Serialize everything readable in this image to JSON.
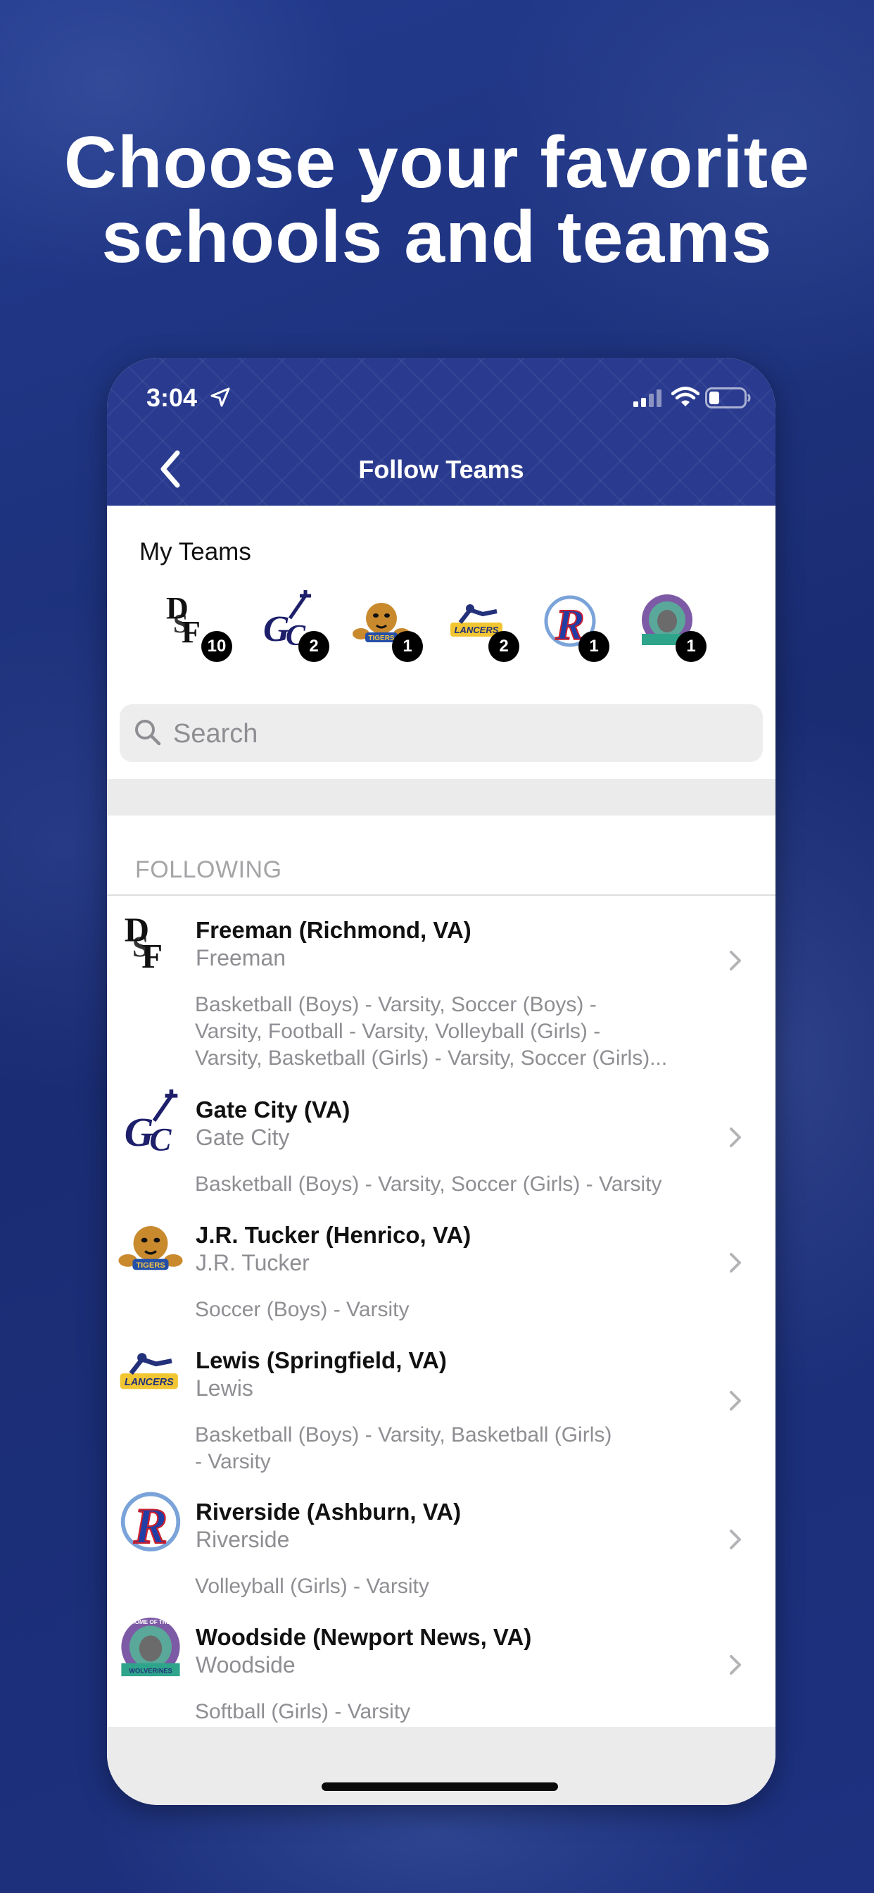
{
  "headline": {
    "line1": "Choose your favorite",
    "line2": "schools and teams"
  },
  "status_bar": {
    "time": "3:04"
  },
  "nav": {
    "title": "Follow Teams"
  },
  "my_teams": {
    "label": "My Teams",
    "badges": [
      {
        "logo": "freeman-logo",
        "count": "10"
      },
      {
        "logo": "gate-city-logo",
        "count": "2"
      },
      {
        "logo": "jr-tucker-logo",
        "count": "1"
      },
      {
        "logo": "lewis-logo",
        "count": "2"
      },
      {
        "logo": "riverside-logo",
        "count": "1"
      },
      {
        "logo": "woodside-logo",
        "count": "1"
      }
    ]
  },
  "search": {
    "placeholder": "Search"
  },
  "following": {
    "label": "FOLLOWING",
    "rows": [
      {
        "title": "Freeman (Richmond, VA)",
        "subtitle": "Freeman",
        "sports_lines": [
          "Basketball (Boys) - Varsity, Soccer (Boys) -",
          "Varsity, Football - Varsity, Volleyball (Girls) -",
          "Varsity, Basketball (Girls) - Varsity, Soccer (Girls)..."
        ]
      },
      {
        "title": "Gate City (VA)",
        "subtitle": "Gate City",
        "sports_lines": [
          "Basketball (Boys) - Varsity, Soccer (Girls) - Varsity"
        ]
      },
      {
        "title": "J.R. Tucker (Henrico, VA)",
        "subtitle": "J.R. Tucker",
        "sports_lines": [
          "Soccer (Boys) - Varsity"
        ]
      },
      {
        "title": "Lewis (Springfield, VA)",
        "subtitle": "Lewis",
        "sports_lines": [
          "Basketball (Boys) - Varsity, Basketball (Girls)",
          "- Varsity"
        ]
      },
      {
        "title": "Riverside (Ashburn, VA)",
        "subtitle": "Riverside",
        "sports_lines": [
          "Volleyball (Girls) - Varsity"
        ]
      },
      {
        "title": "Woodside (Newport News, VA)",
        "subtitle": "Woodside",
        "sports_lines": [
          "Softball (Girls) - Varsity"
        ]
      }
    ]
  },
  "logo_text": {
    "jr_tucker": "TIGERS",
    "lewis": "LANCERS",
    "woodside_top": "HOME OF THE",
    "woodside_bottom": "WOLVERINES"
  },
  "colors": {
    "background": "#1c2f78",
    "header": "#2a3b8f",
    "badge": "#000000",
    "secondary_text": "#8e8e93"
  }
}
